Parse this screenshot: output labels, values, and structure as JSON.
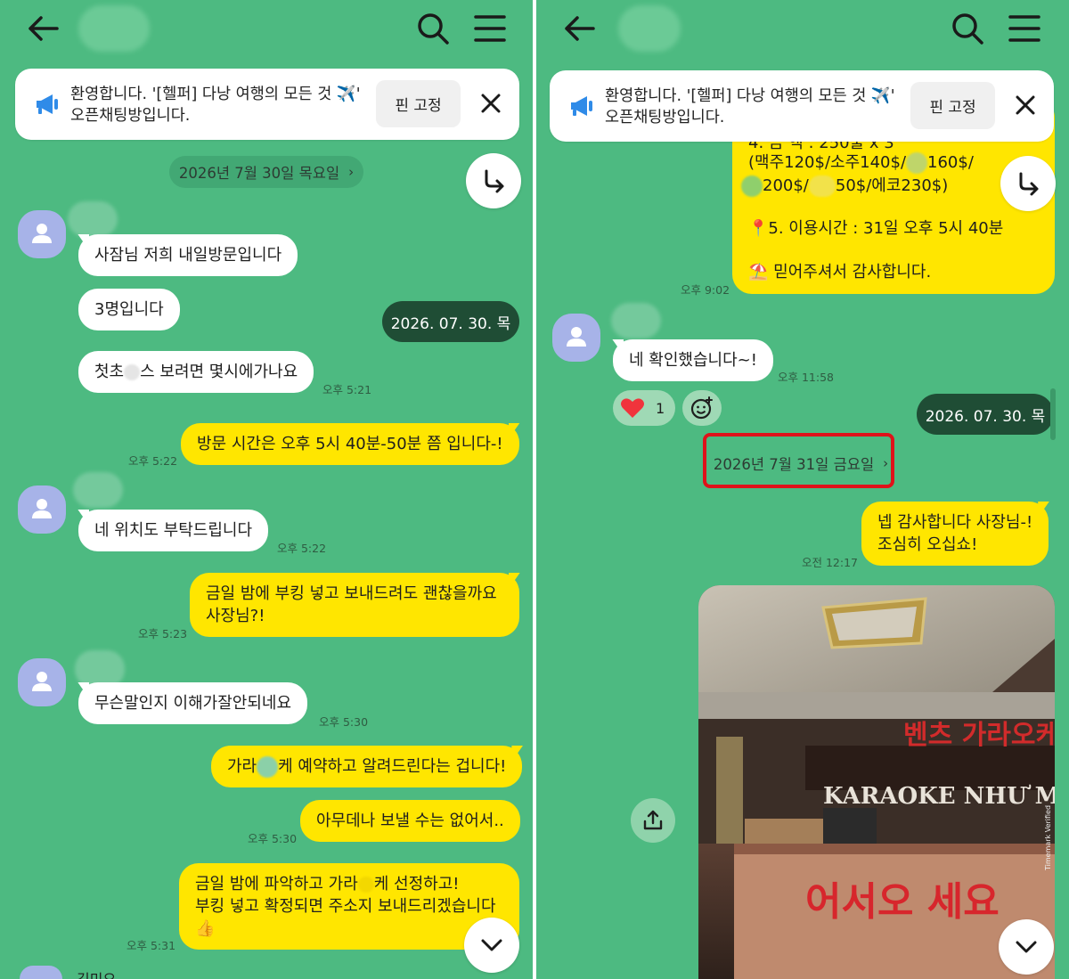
{
  "colors": {
    "chat_bg": "#4dba81",
    "incoming": "#ffffff",
    "outgoing": "#ffe600",
    "date_chip_dark": "#1f4d35",
    "highlight": "#e0121a"
  },
  "notice": {
    "line1": "환영합니다. '[헬퍼] 다낭 여행의 모든 것 ✈️'",
    "line2": "오픈채팅방입니다.",
    "pin_label": "핀 고정",
    "icon": "megaphone-icon"
  },
  "left": {
    "date_divider": "2026년 7월 30일 목요일",
    "date_chip": "2026. 07. 30. 목",
    "messages": [
      {
        "text": "사잠님 저희 내일방문입니다"
      },
      {
        "text": "3명입니다"
      },
      {
        "text_a": "첫초",
        "text_b": "스 보려면 몇시에가나요",
        "time": "오후 5:21"
      },
      {
        "text": "방문 시간은 오후 5시 40분-50분 쯤 입니다-!",
        "time": "오후 5:22"
      },
      {
        "text": "네 위치도 부탁드립니다",
        "time": "오후 5:22"
      },
      {
        "text_l1": "금일 밤에 부킹 넣고 보내드려도 괜찮을까요",
        "text_l2": "사장님?!",
        "time": "오후 5:23"
      },
      {
        "text": "무슨말인지 이해가잘안되네요",
        "time": "오후 5:30"
      },
      {
        "text_a": "가라",
        "text_b": "케 예약하고 알려드린다는 겁니다!"
      },
      {
        "text": "아무데나 보낼 수는 없어서..",
        "time": "오후 5:30"
      },
      {
        "text_l1a": "금일 밤에 파악하고 가라",
        "text_l1b": "케 선정하고!",
        "text_l2": "부킹 넣고 확정되면 주소지 보내드리겠습니다",
        "text_l3": "👍",
        "time": "오후 5:31"
      }
    ],
    "partial_name": "김미요"
  },
  "right": {
    "menu_top_partial": "4. 금 액 : 250불 x 3",
    "menu_line1": "(맥주120$/소주140$/",
    "menu_line1b": "160$/",
    "menu_line2a": "200$/",
    "menu_line2b": "50$/에코230$)",
    "menu_line3": "📍5. 이용시간 : 31일 오후 5시 40분",
    "menu_line4": "⛱️ 믿어주셔서 감사합니다.",
    "menu_time": "오후 9:02",
    "reply": {
      "text": "네 확인했습니다~!",
      "time": "오후 11:58"
    },
    "reaction_count": "1",
    "date_chip": "2026. 07. 30. 목",
    "date_divider": "2026년 7월 31일 금요일",
    "thanks": {
      "line1": "넵 감사합니다 사장님-!",
      "line2": "조심히 오십쇼!",
      "time": "오전 12:17"
    },
    "photo": {
      "sign_ko": "벤츠 가라오케",
      "sign_en": "KARAOKE NHƯ M",
      "counter": "어서오 세요",
      "watermark": "Timemark Verified"
    }
  }
}
